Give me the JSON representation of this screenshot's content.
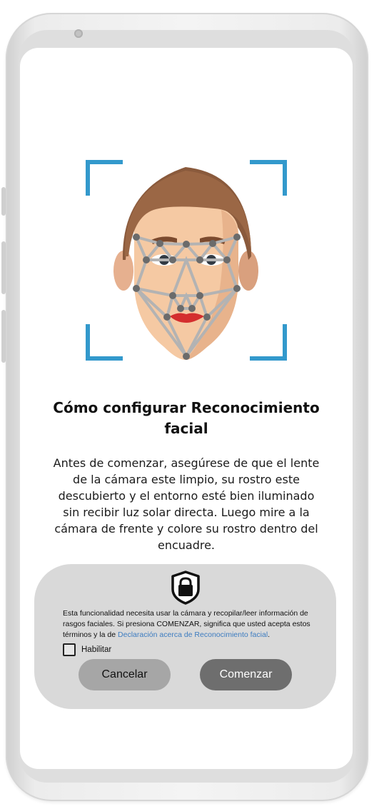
{
  "screen": {
    "title": "Cómo configurar Reconocimiento facial",
    "description": "Antes de comenzar, asegúrese de que el lente de la cámara este limpio, su rostro este descubierto y el entorno esté bien iluminado sin recibir luz solar directa. Luego mire a la cámara de frente y colore su rostro dentro del encuadre."
  },
  "illustration": {
    "icon": "face-scan-icon"
  },
  "consent": {
    "icon": "shield-lock-icon",
    "terms_text": "Esta funcionalidad necesita usar la cámara y recopilar/leer información de rasgos faciales. Si presiona COMENZAR, significa que usted acepta estos términos y la de ",
    "terms_link": "Declaración acerca de Reconocimiento facial",
    "terms_end": ".",
    "checkbox_label": "Habilitar",
    "checkbox_checked": false,
    "cancel_label": "Cancelar",
    "start_label": "Comenzar"
  },
  "colors": {
    "frame_blue": "#3399cc",
    "link_blue": "#3d7cc0",
    "panel_gray": "#d9d9d9",
    "cancel_gray": "#a6a6a6",
    "start_gray": "#6e6e6e"
  }
}
